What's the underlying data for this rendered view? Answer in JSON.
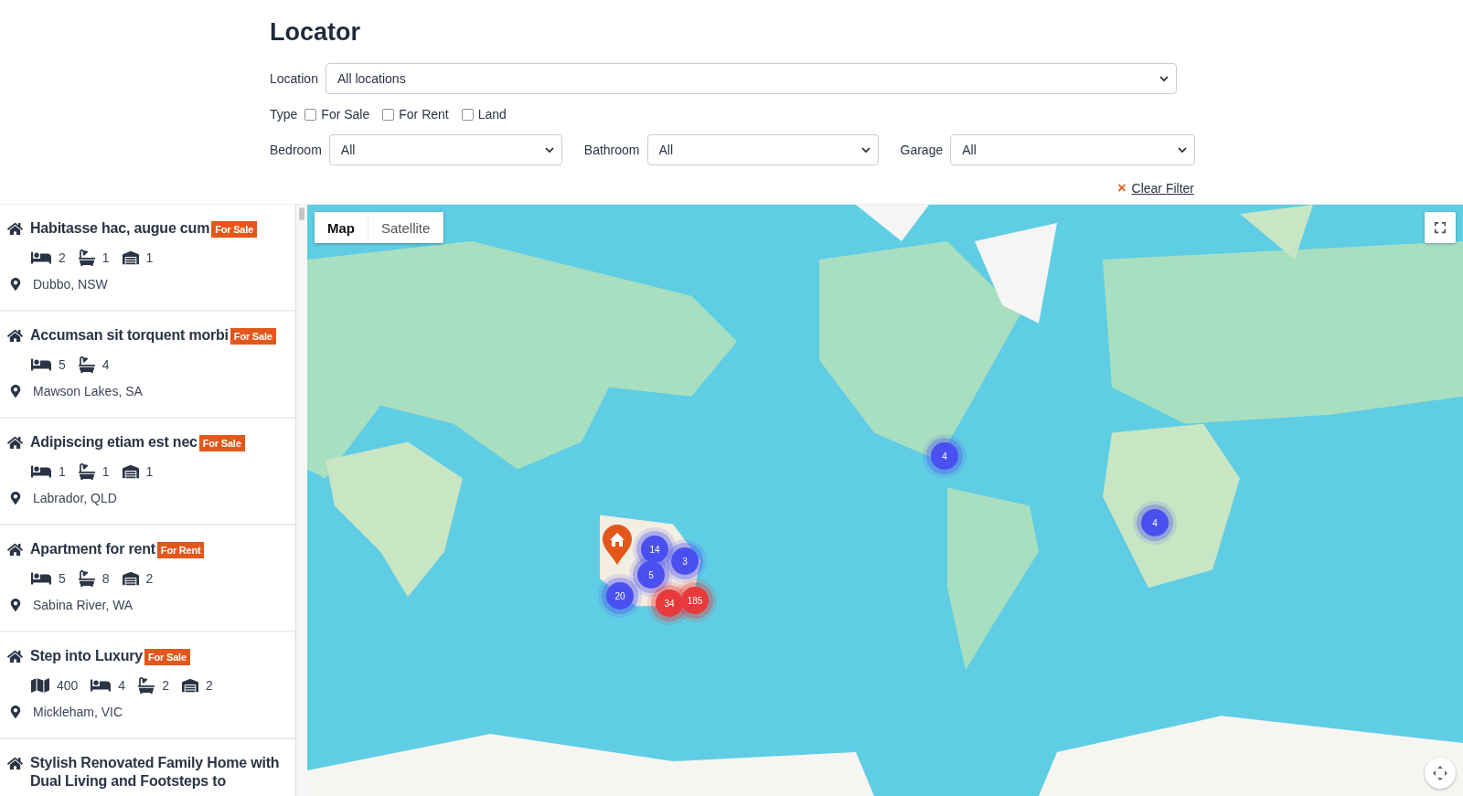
{
  "title": "Locator",
  "filters": {
    "location": {
      "label": "Location",
      "value": "All locations"
    },
    "type": {
      "label": "Type",
      "options": [
        {
          "label": "For Sale",
          "checked": false
        },
        {
          "label": "For Rent",
          "checked": false
        },
        {
          "label": "Land",
          "checked": false
        }
      ]
    },
    "selects": [
      {
        "label": "Bedroom",
        "value": "All"
      },
      {
        "label": "Bathroom",
        "value": "All"
      },
      {
        "label": "Garage",
        "value": "All"
      }
    ],
    "clear": {
      "icon": "×",
      "label": "Clear Filter"
    }
  },
  "listings": [
    {
      "title": "Habitasse hac, augue cum",
      "badge": "For Sale",
      "features": [
        {
          "kind": "bed",
          "value": "2"
        },
        {
          "kind": "bath",
          "value": "1"
        },
        {
          "kind": "garage",
          "value": "1"
        }
      ],
      "location": "Dubbo, NSW"
    },
    {
      "title": "Accumsan sit torquent morbi",
      "badge": "For Sale",
      "features": [
        {
          "kind": "bed",
          "value": "5"
        },
        {
          "kind": "bath",
          "value": "4"
        }
      ],
      "location": "Mawson Lakes, SA"
    },
    {
      "title": "Adipiscing etiam est nec",
      "badge": "For Sale",
      "features": [
        {
          "kind": "bed",
          "value": "1"
        },
        {
          "kind": "bath",
          "value": "1"
        },
        {
          "kind": "garage",
          "value": "1"
        }
      ],
      "location": "Labrador, QLD"
    },
    {
      "title": "Apartment for rent",
      "badge": "For Rent",
      "features": [
        {
          "kind": "bed",
          "value": "5"
        },
        {
          "kind": "bath",
          "value": "8"
        },
        {
          "kind": "garage",
          "value": "2"
        }
      ],
      "location": "Sabina River, WA"
    },
    {
      "title": "Step into Luxury",
      "badge": "For Sale",
      "features": [
        {
          "kind": "area",
          "value": "400"
        },
        {
          "kind": "bed",
          "value": "4"
        },
        {
          "kind": "bath",
          "value": "2"
        },
        {
          "kind": "garage",
          "value": "2"
        }
      ],
      "location": "Mickleham, VIC"
    },
    {
      "title": "Stylish Renovated Family Home with Dual Living and Footsteps to"
    }
  ],
  "map": {
    "tabs": [
      {
        "label": "Map",
        "selected": true
      },
      {
        "label": "Satellite",
        "selected": false
      }
    ],
    "clusters": [
      {
        "count": "14",
        "color": "#4a4ff0"
      },
      {
        "count": "3",
        "color": "#4a4ff0"
      },
      {
        "count": "5",
        "color": "#4a4ff0"
      },
      {
        "count": "20",
        "color": "#4a4ff0"
      },
      {
        "count": "34",
        "color": "#e8393b"
      },
      {
        "count": "185",
        "color": "#e8393b"
      },
      {
        "count": "4",
        "color": "#4a4ff0"
      },
      {
        "count": "4",
        "color": "#4a4ff0"
      }
    ]
  }
}
